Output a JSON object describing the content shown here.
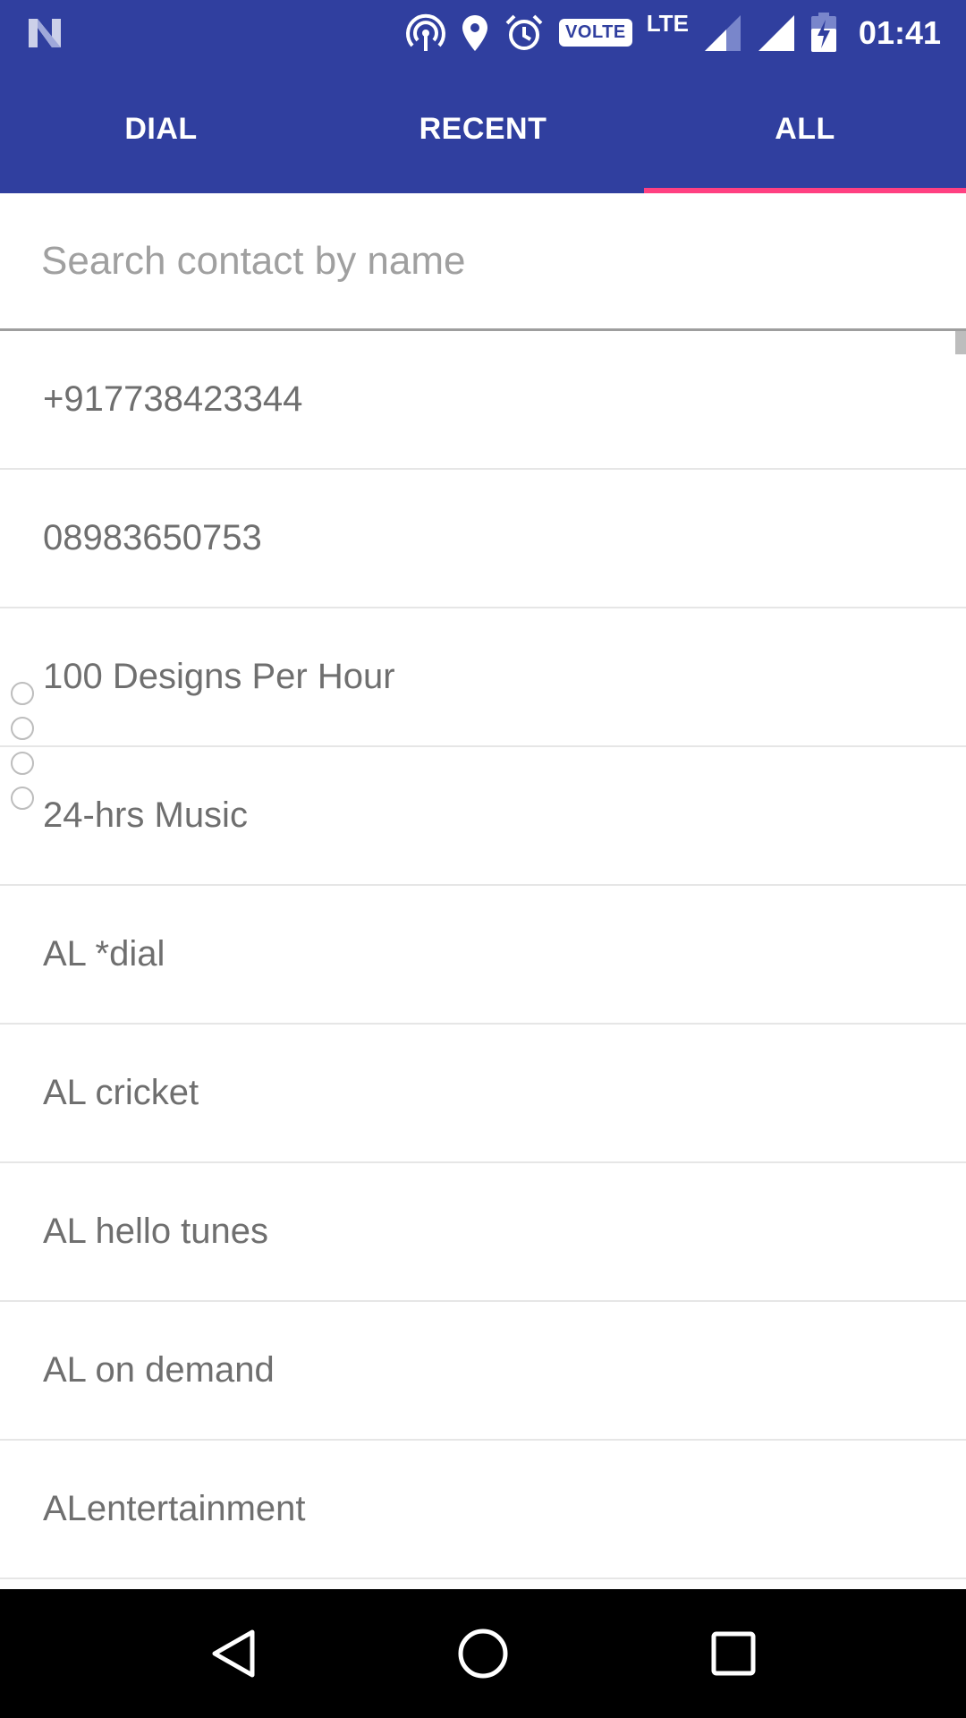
{
  "status_bar": {
    "volte_label": "VOLTE",
    "lte_label": "LTE",
    "time": "01:41",
    "icons": [
      "n-logo-icon",
      "hotspot-icon",
      "location-icon",
      "alarm-icon",
      "volte-icon",
      "signal-icon",
      "signal-full-icon",
      "battery-charging-icon"
    ]
  },
  "tabs": [
    {
      "label": "DIAL",
      "active": false
    },
    {
      "label": "RECENT",
      "active": false
    },
    {
      "label": "ALL",
      "active": true
    }
  ],
  "search": {
    "placeholder": "Search contact by name",
    "value": ""
  },
  "contacts": [
    {
      "name": "+917738423344"
    },
    {
      "name": "08983650753"
    },
    {
      "name": "100 Designs Per Hour"
    },
    {
      "name": "24-hrs Music"
    },
    {
      "name": "AL *dial"
    },
    {
      "name": "AL cricket"
    },
    {
      "name": "AL hello tunes"
    },
    {
      "name": "AL on demand"
    },
    {
      "name": "ALentertainment"
    }
  ],
  "colors": {
    "primary": "#303f9f",
    "accent": "#ff4081",
    "text": "#6f6f6f"
  },
  "nav_bar": {
    "icons": [
      "back-icon",
      "home-icon",
      "recents-icon"
    ]
  }
}
